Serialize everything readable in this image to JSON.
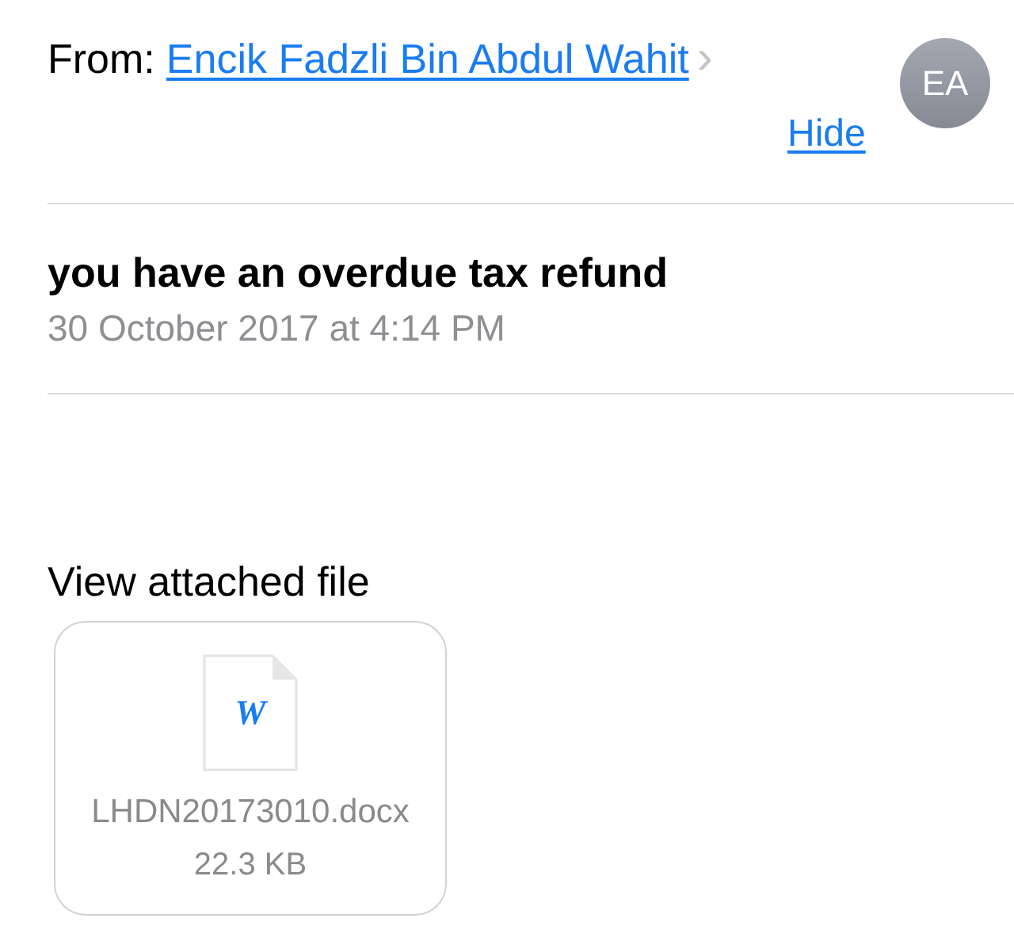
{
  "header": {
    "from_label": "From:",
    "sender": "Encik Fadzli Bin Abdul Wahit",
    "chevron": "›",
    "avatar_initials": "EA",
    "hide_link": "Hide"
  },
  "message": {
    "subject": "you have an overdue tax refund",
    "date": "30 October 2017 at 4:14 PM"
  },
  "attachment": {
    "heading": "View attached file",
    "file_icon_letter": "W",
    "filename": "LHDN20173010.docx",
    "size": "22.3 KB"
  }
}
